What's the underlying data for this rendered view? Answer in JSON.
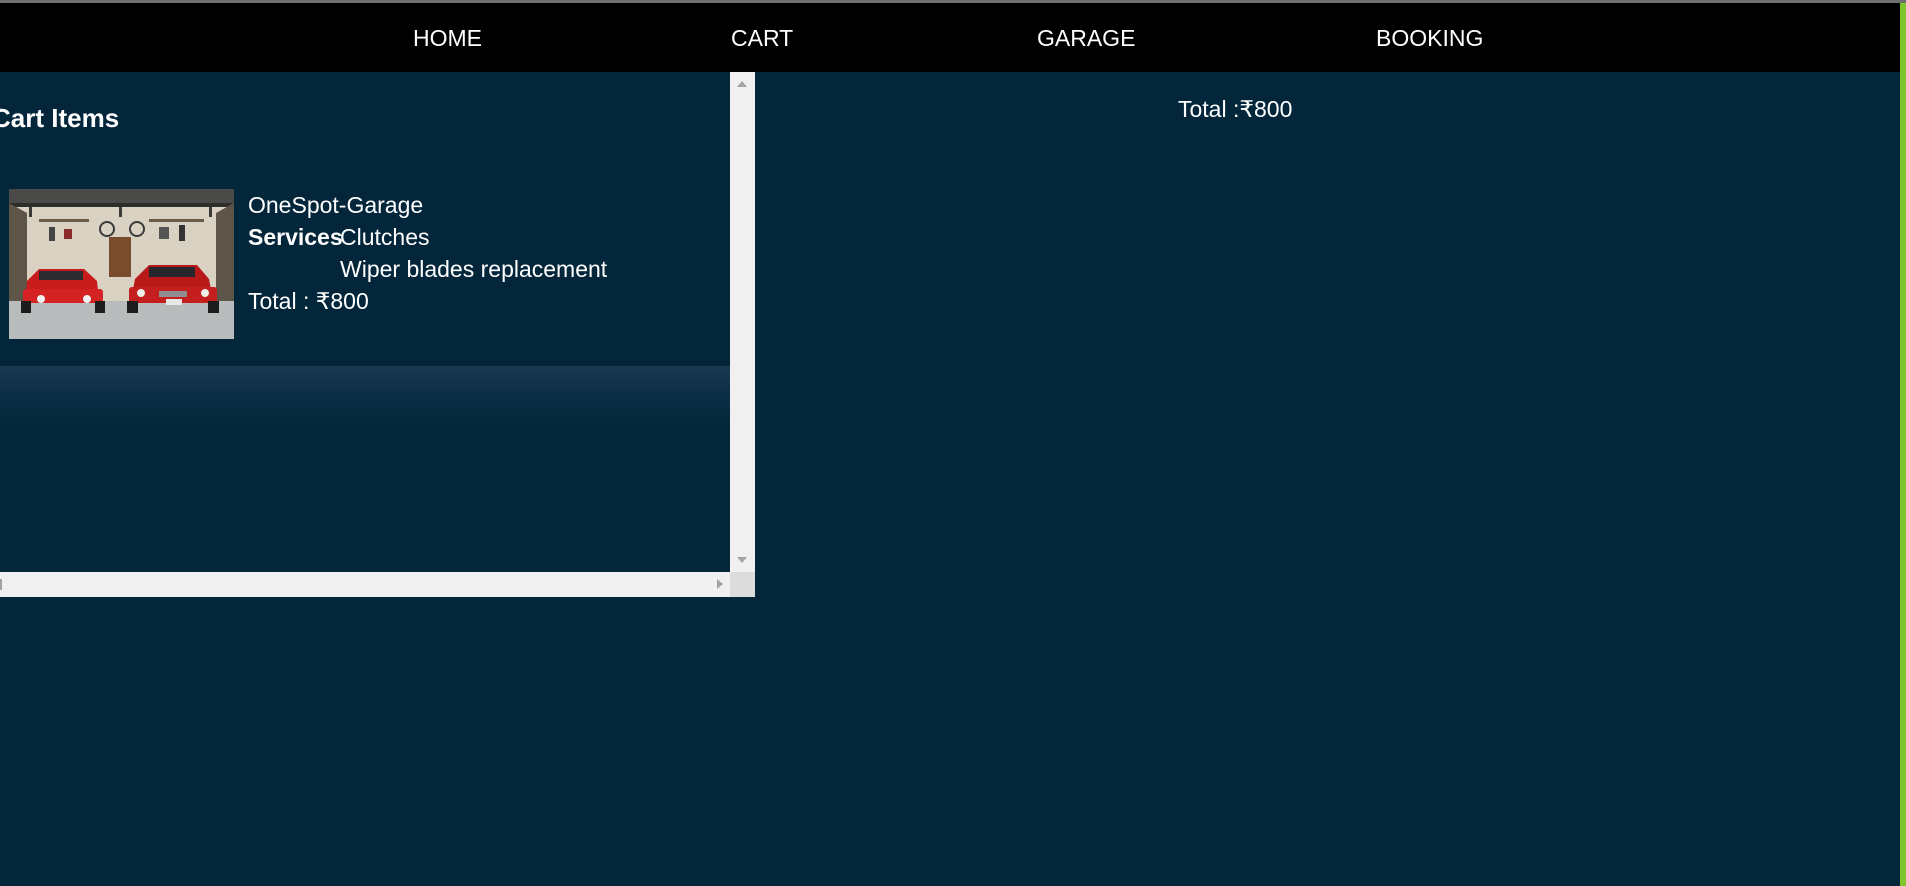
{
  "nav": {
    "items": [
      "HOME",
      "CART",
      "GARAGE",
      "BOOKING"
    ]
  },
  "cart": {
    "title": "Cart Items",
    "items": [
      {
        "garage_name": "OneSpot-Garage",
        "services_label": "Services",
        "services": [
          "Clutches",
          "Wiper blades replacement"
        ],
        "total": "Total : ₹800"
      }
    ]
  },
  "summary": {
    "total": "Total :₹800"
  },
  "colors": {
    "background": "#03263b",
    "navbar": "#000000",
    "accent": "#7cc52b",
    "text": "#ffffff"
  }
}
